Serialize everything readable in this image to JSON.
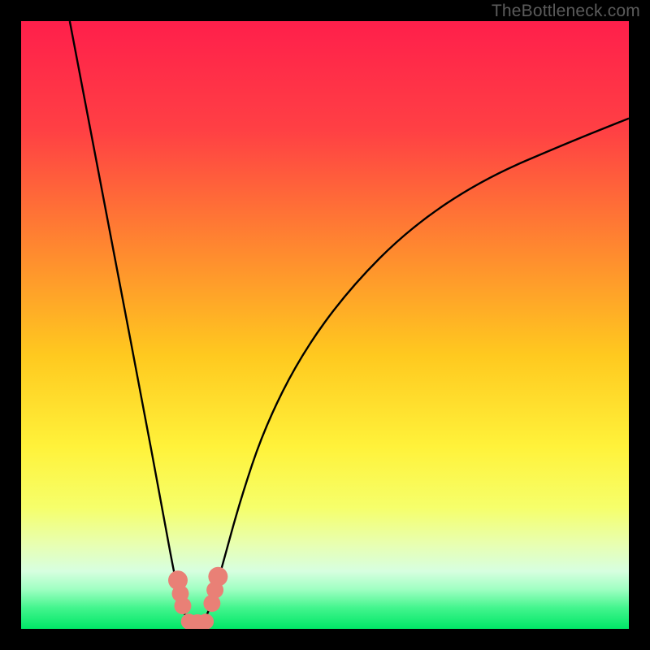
{
  "watermark": "TheBottleneck.com",
  "chart_data": {
    "type": "line",
    "title": "",
    "xlabel": "",
    "ylabel": "",
    "xlim": [
      0,
      100
    ],
    "ylim": [
      0,
      100
    ],
    "series": [
      {
        "name": "bottleneck-curve",
        "x": [
          8,
          12,
          16,
          20,
          23,
          25,
          26.5,
          28,
          29.5,
          31,
          33,
          36,
          40,
          46,
          54,
          64,
          76,
          90,
          100
        ],
        "y": [
          100,
          79,
          58,
          37,
          21,
          10,
          3,
          0.5,
          0.5,
          3,
          10,
          21,
          33,
          45,
          56,
          66,
          74,
          80,
          84
        ]
      }
    ],
    "markers": [
      {
        "name": "marker-left",
        "x": 25.8,
        "y": 8.0,
        "r": 1.6
      },
      {
        "name": "marker-left",
        "x": 26.2,
        "y": 5.8,
        "r": 1.4
      },
      {
        "name": "marker-left",
        "x": 26.6,
        "y": 3.8,
        "r": 1.4
      },
      {
        "name": "marker-low",
        "x": 27.6,
        "y": 1.2,
        "r": 1.3
      },
      {
        "name": "marker-low",
        "x": 29.0,
        "y": 0.8,
        "r": 1.6
      },
      {
        "name": "marker-low",
        "x": 30.4,
        "y": 1.2,
        "r": 1.3
      },
      {
        "name": "marker-right",
        "x": 31.4,
        "y": 4.2,
        "r": 1.4
      },
      {
        "name": "marker-right",
        "x": 31.9,
        "y": 6.4,
        "r": 1.4
      },
      {
        "name": "marker-right",
        "x": 32.4,
        "y": 8.6,
        "r": 1.6
      }
    ],
    "gradient_stops": [
      {
        "offset": 0.0,
        "color": "#ff1f4b"
      },
      {
        "offset": 0.18,
        "color": "#ff4044"
      },
      {
        "offset": 0.38,
        "color": "#ff8a2f"
      },
      {
        "offset": 0.55,
        "color": "#ffc91f"
      },
      {
        "offset": 0.7,
        "color": "#fff23a"
      },
      {
        "offset": 0.8,
        "color": "#f6ff6a"
      },
      {
        "offset": 0.86,
        "color": "#e8ffb0"
      },
      {
        "offset": 0.905,
        "color": "#d7ffe0"
      },
      {
        "offset": 0.935,
        "color": "#9fffc2"
      },
      {
        "offset": 0.965,
        "color": "#44f58e"
      },
      {
        "offset": 1.0,
        "color": "#00e767"
      }
    ],
    "marker_color": "#e98076",
    "curve_color": "#000000"
  }
}
